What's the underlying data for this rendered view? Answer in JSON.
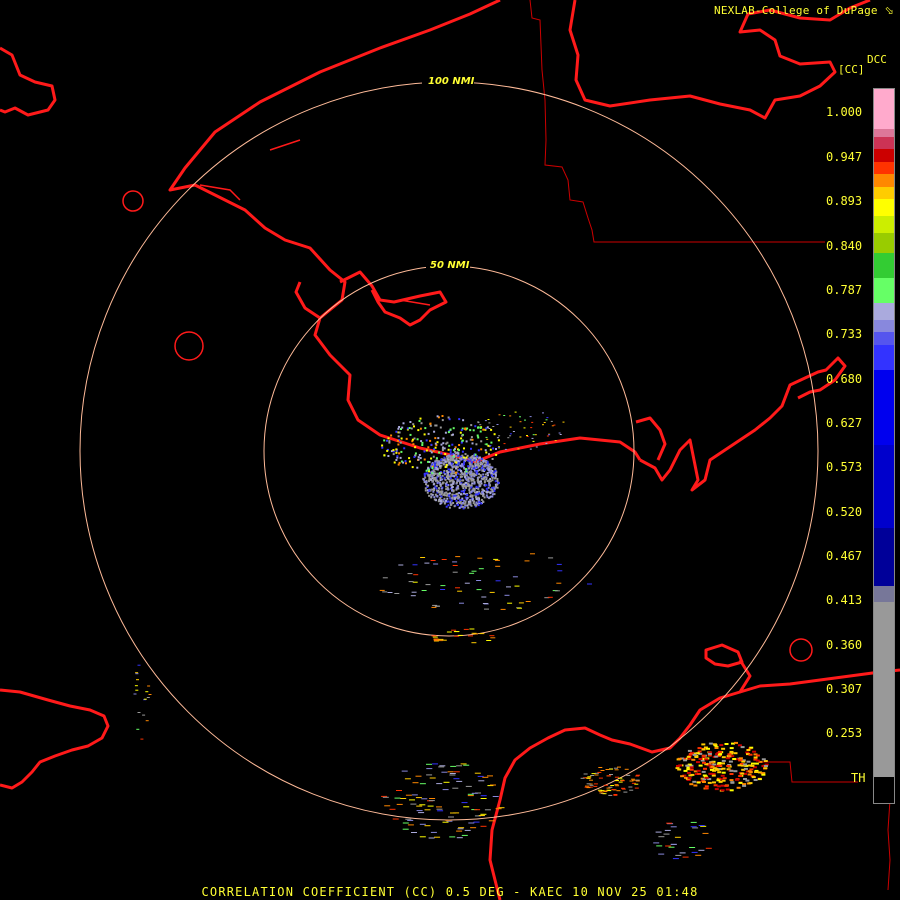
{
  "credit": "NEXLAB-College of DuPage",
  "credit_icon": "nexlab-arrow-icon",
  "product_code": "DCC",
  "unit": "[CC]",
  "ring_labels": [
    "100 NMI",
    "50 NMI"
  ],
  "legend_ticks": [
    "1.000",
    "0.947",
    "0.893",
    "0.840",
    "0.787",
    "0.733",
    "0.680",
    "0.627",
    "0.573",
    "0.520",
    "0.467",
    "0.413",
    "0.360",
    "0.307",
    "0.253",
    "TH"
  ],
  "color_scale": [
    {
      "from": 0.98,
      "to": 1.05,
      "color": "#ffaacc"
    },
    {
      "from": 0.97,
      "to": 0.98,
      "color": "#dd7799"
    },
    {
      "from": 0.955,
      "to": 0.97,
      "color": "#cc3355"
    },
    {
      "from": 0.94,
      "to": 0.955,
      "color": "#cc0000"
    },
    {
      "from": 0.925,
      "to": 0.94,
      "color": "#ff3300"
    },
    {
      "from": 0.91,
      "to": 0.925,
      "color": "#ff8800"
    },
    {
      "from": 0.895,
      "to": 0.91,
      "color": "#ffcc00"
    },
    {
      "from": 0.875,
      "to": 0.895,
      "color": "#ffff00"
    },
    {
      "from": 0.855,
      "to": 0.875,
      "color": "#ccee00"
    },
    {
      "from": 0.83,
      "to": 0.855,
      "color": "#99cc00"
    },
    {
      "from": 0.8,
      "to": 0.83,
      "color": "#33cc33"
    },
    {
      "from": 0.77,
      "to": 0.8,
      "color": "#66ff66"
    },
    {
      "from": 0.75,
      "to": 0.77,
      "color": "#aaaadd"
    },
    {
      "from": 0.735,
      "to": 0.75,
      "color": "#8888dd"
    },
    {
      "from": 0.72,
      "to": 0.735,
      "color": "#5555ee"
    },
    {
      "from": 0.69,
      "to": 0.72,
      "color": "#3333ff"
    },
    {
      "from": 0.6,
      "to": 0.69,
      "color": "#0000ee"
    },
    {
      "from": 0.5,
      "to": 0.6,
      "color": "#0000cc"
    },
    {
      "from": 0.43,
      "to": 0.5,
      "color": "#000099"
    },
    {
      "from": 0.41,
      "to": 0.43,
      "color": "#777799"
    },
    {
      "from": 0.2,
      "to": 0.41,
      "color": "#999999"
    },
    {
      "from": 0.195,
      "to": 0.2,
      "color": "#000000"
    }
  ],
  "caption": "CORRELATION COEFFICIENT (CC) 0.5 DEG - KAEC 10 NOV 25 01:48",
  "colors": {
    "background": "#000000",
    "label": "#ffff33",
    "coastline": "#ff0000",
    "border": "#cc0000",
    "range_ring": "#ffbb99"
  }
}
